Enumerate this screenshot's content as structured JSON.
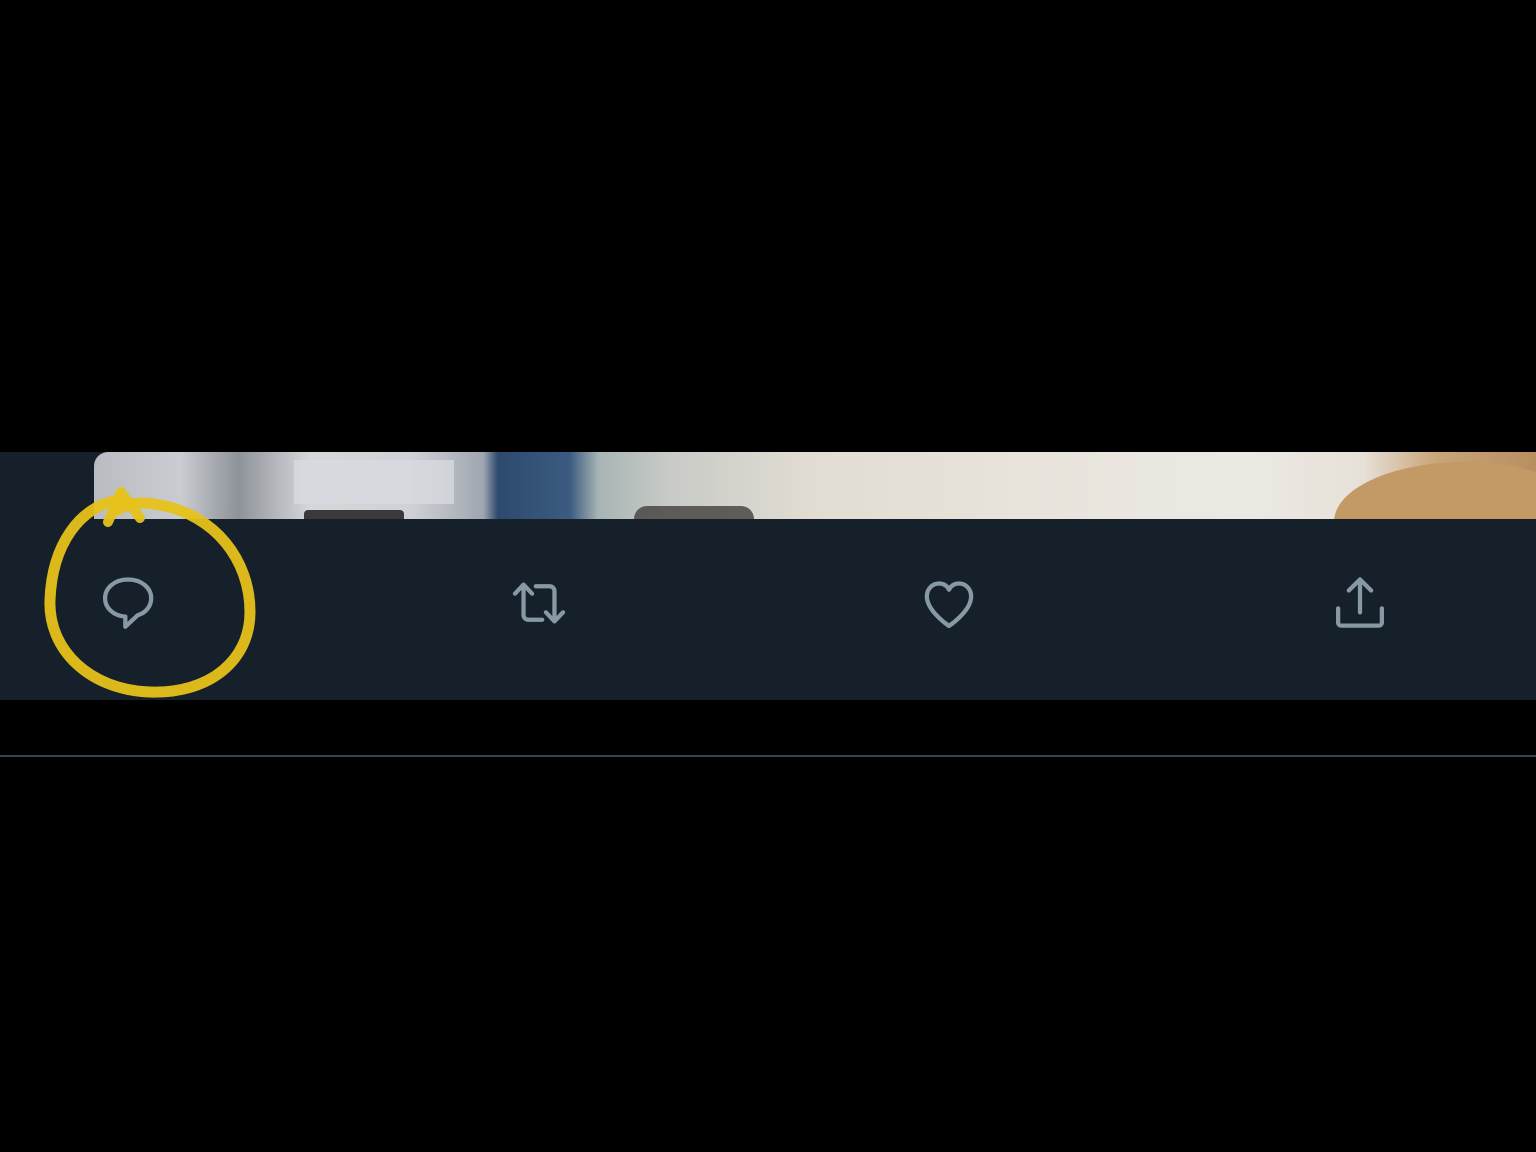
{
  "colors": {
    "page_background": "#000000",
    "tweet_background": "#15202b",
    "icon_color": "#8899a6",
    "divider": "#38444d",
    "highlight_marker": "#e6c21a"
  },
  "tweet": {
    "media": {
      "icon": "media-image"
    },
    "actions": [
      {
        "name": "reply",
        "icon": "reply-icon"
      },
      {
        "name": "retweet",
        "icon": "retweet-icon"
      },
      {
        "name": "like",
        "icon": "like-icon"
      },
      {
        "name": "share",
        "icon": "share-icon"
      }
    ]
  },
  "annotation": {
    "type": "hand-drawn circle",
    "target": "reply",
    "color": "#e6c21a"
  }
}
